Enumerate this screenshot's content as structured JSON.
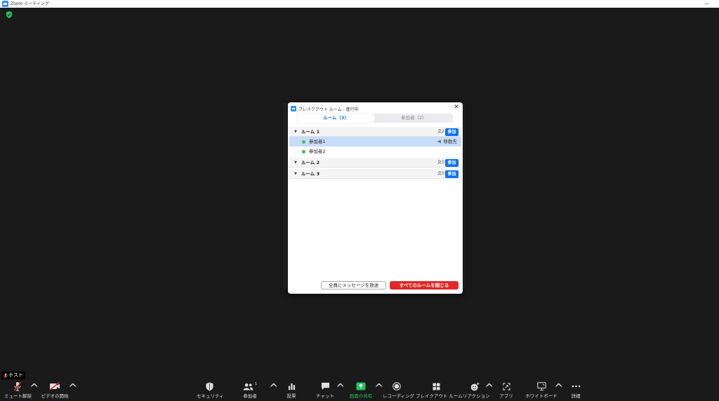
{
  "window": {
    "title": "Zoom ミーティング",
    "controls": "—"
  },
  "dialog": {
    "title": "ブレイクアウト ルーム - 進行中",
    "close_glyph": "✕",
    "tabs": [
      "ルーム（3）",
      "参加者（2）"
    ],
    "active_tab": 0,
    "rooms": [
      {
        "name": "ルーム 1",
        "count": "2",
        "join": "参加"
      },
      {
        "name": "ルーム 2",
        "count": "0",
        "join": "参加"
      },
      {
        "name": "ルーム 3",
        "count": "0",
        "join": "参加"
      }
    ],
    "participants": [
      {
        "name": "参加者1",
        "action": "移動先",
        "selected": true
      },
      {
        "name": "参加者2",
        "action": "",
        "selected": false
      }
    ],
    "broadcast_button": "全員にメッセージを放送",
    "close_all_button": "すべてのルームを閉じる",
    "colors": {
      "accent": "#0e72ed",
      "danger": "#e02828",
      "online": "#3fbf5f"
    }
  },
  "host_badge": {
    "label": "ホスト",
    "icon": "muted-mic-icon"
  },
  "toolbar": {
    "unmute": "ミュート解除",
    "start_video": "ビデオの開始",
    "security": "セキュリティ",
    "participants": "参加者",
    "participants_count": "1",
    "polls": "投票",
    "chat": "チャット",
    "share_screen": "画面の共有",
    "recording": "レコーディング",
    "breakout_rooms": "ブレイクアウト ルーム",
    "reactions": "リアクション",
    "apps": "アプリ",
    "whiteboard": "ホワイトボード",
    "more": "詳細"
  }
}
